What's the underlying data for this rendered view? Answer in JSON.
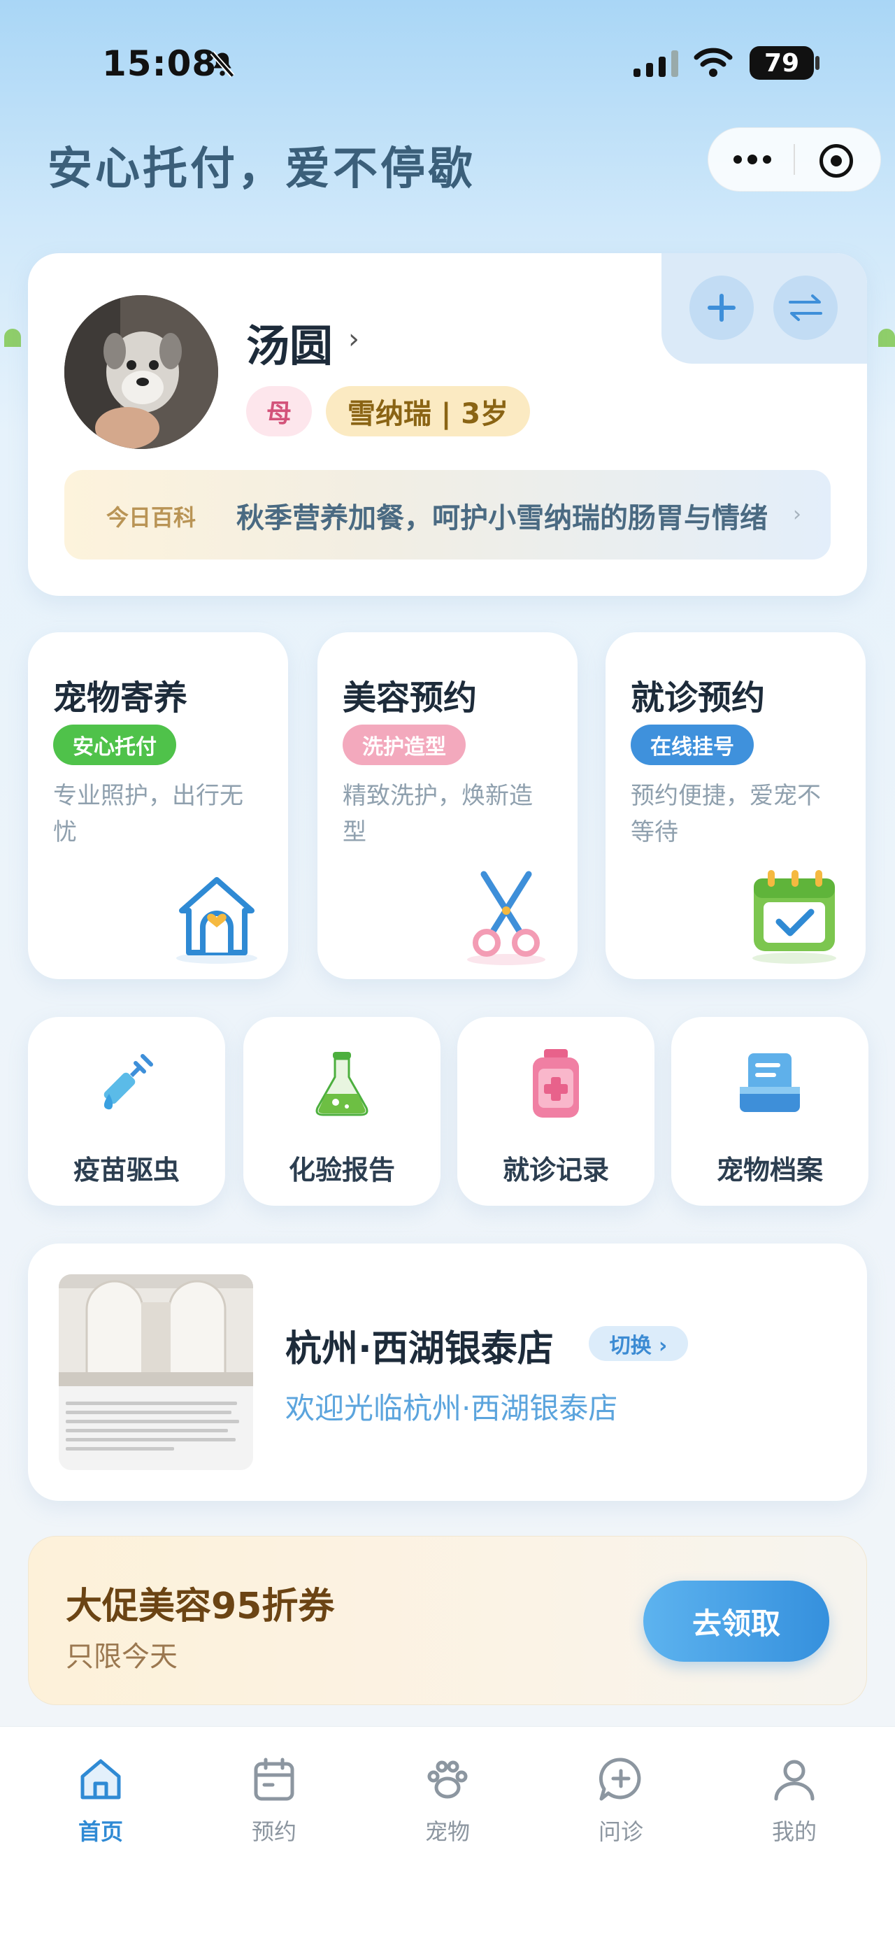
{
  "status_bar": {
    "time": "15:08",
    "battery": "79"
  },
  "header": {
    "slogan": "安心托付，爱不停歇"
  },
  "pet": {
    "name": "汤圆",
    "gender": "母",
    "breed_age": "雪纳瑞 | 3岁",
    "tip_label": "今日百科",
    "tip_text": "秋季营养加餐，呵护小雪纳瑞的肠胃与情绪"
  },
  "services": [
    {
      "title": "宠物寄养",
      "badge": "安心托付",
      "desc": "专业照护，出行无忧",
      "badge_color": "#4fc24a"
    },
    {
      "title": "美容预约",
      "badge": "洗护造型",
      "desc": "精致洗护，焕新造型",
      "badge_color": "#f3a9bd"
    },
    {
      "title": "就诊预约",
      "badge": "在线挂号",
      "desc": "预约便捷，爱宠不等待",
      "badge_color": "#3f91dc"
    }
  ],
  "quick_links": [
    {
      "label": "疫苗驱虫",
      "icon": "syringe-icon"
    },
    {
      "label": "化验报告",
      "icon": "flask-icon"
    },
    {
      "label": "就诊记录",
      "icon": "medical-bottle-icon"
    },
    {
      "label": "宠物档案",
      "icon": "file-archive-icon"
    }
  ],
  "store": {
    "name": "杭州·西湖银泰店",
    "switch_label": "切换 ›",
    "welcome": "欢迎光临杭州·西湖银泰店"
  },
  "promo": {
    "title": "大促美容95折券",
    "subtitle": "只限今天",
    "button": "去领取"
  },
  "tabbar": {
    "items": [
      {
        "label": "首页",
        "icon": "home-icon",
        "active": true
      },
      {
        "label": "预约",
        "icon": "calendar-icon",
        "active": false
      },
      {
        "label": "宠物",
        "icon": "paw-icon",
        "active": false
      },
      {
        "label": "问诊",
        "icon": "chat-plus-icon",
        "active": false
      },
      {
        "label": "我的",
        "icon": "user-icon",
        "active": false
      }
    ]
  },
  "colors": {
    "accent": "#3590dd",
    "slogan": "#3b5f7a",
    "promo_text": "#6b4414"
  }
}
